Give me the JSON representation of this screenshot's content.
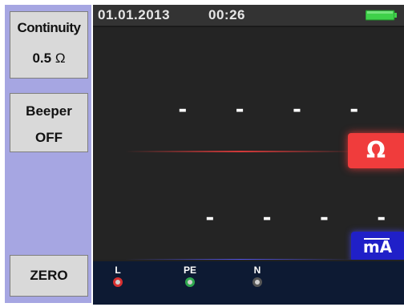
{
  "sidebar": {
    "continuity": {
      "label": "Continuity",
      "value": "0.5",
      "unit": "Ω"
    },
    "beeper": {
      "label": "Beeper",
      "value": "OFF"
    },
    "zero": {
      "label": "ZERO"
    }
  },
  "statusbar": {
    "date": "01.01.2013",
    "time": "00:26",
    "battery_icon": "battery-full-icon"
  },
  "readings": {
    "primary": {
      "value": "- - - -",
      "unit": "Ω",
      "unit_color": "#f03c3c"
    },
    "secondary": {
      "value": "- - - -",
      "unit": "mA",
      "unit_color": "#2020c8"
    }
  },
  "terminals": [
    {
      "label": "L",
      "ring_color": "#d83030"
    },
    {
      "label": "PE",
      "ring_color": "#2fa84f"
    },
    {
      "label": "N",
      "ring_color": "#555555"
    }
  ]
}
